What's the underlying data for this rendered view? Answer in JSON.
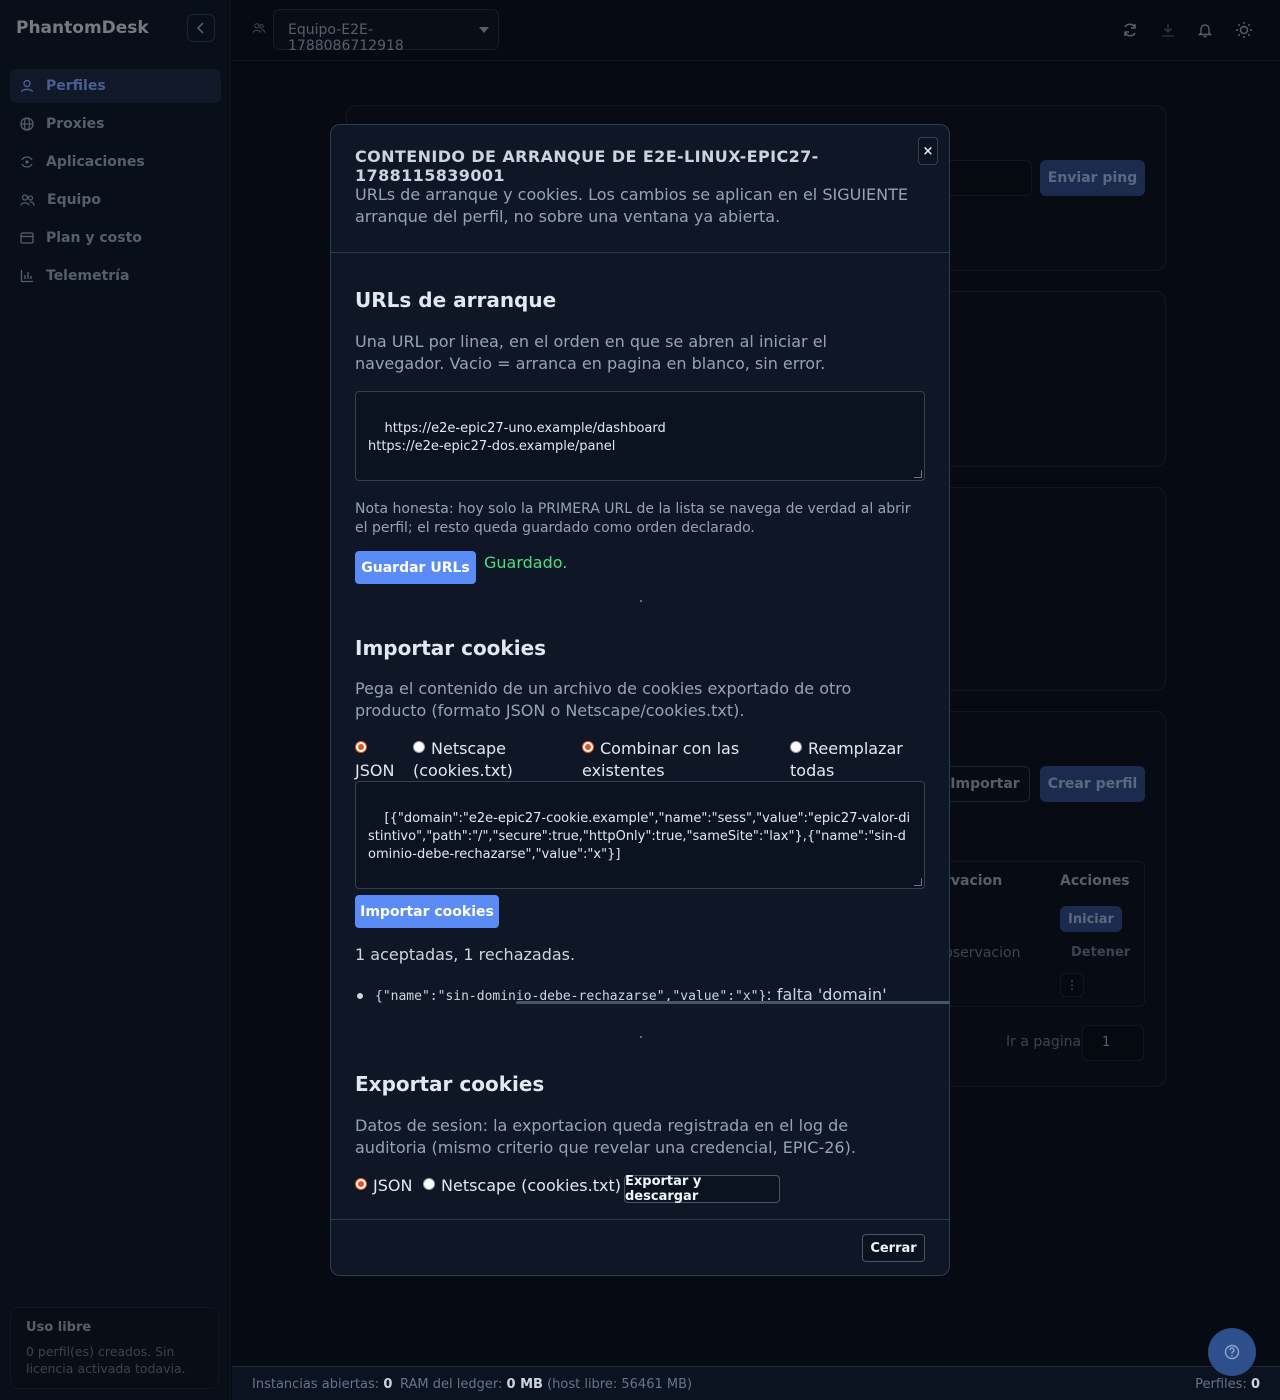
{
  "app": {
    "brand": "PhantomDesk"
  },
  "sidebar": {
    "items": [
      {
        "label": "Perfiles",
        "icon": "user-icon",
        "active": true
      },
      {
        "label": "Proxies",
        "icon": "globe-icon"
      },
      {
        "label": "Aplicaciones",
        "icon": "apps-icon"
      },
      {
        "label": "Equipo",
        "icon": "team-icon"
      },
      {
        "label": "Plan y costo",
        "icon": "card-icon"
      },
      {
        "label": "Telemetría",
        "icon": "chart-icon"
      }
    ],
    "usage": {
      "title": "Uso libre",
      "text": "0 perfil(es) creados. Sin licencia activada todavia."
    }
  },
  "topbar": {
    "team": "Equipo-E2E-1788086712918"
  },
  "background": {
    "ping_button": "Enviar ping",
    "import_button": "Importar",
    "create_button": "Crear perfil",
    "col_observacion": "rvacion",
    "col_acciones": "Acciones",
    "start_button": "Iniciar",
    "stop_button": "Detener",
    "observacion_cell": "bservacion",
    "goto_page_label": "Ir a pagina",
    "goto_page_value": "1"
  },
  "modal": {
    "title": "CONTENIDO DE ARRANQUE DE E2E-LINUX-EPIC27-1788115839001",
    "description": "URLs de arranque y cookies. Los cambios se aplican en el SIGUIENTE arranque del perfil, no sobre una ventana ya abierta.",
    "close_x": "×",
    "urls": {
      "heading": "URLs de arranque",
      "help": "Una URL por linea, en el orden en que se abren al iniciar el navegador. Vacio = arranca en pagina en blanco, sin error.",
      "value": "https://e2e-epic27-uno.example/dashboard\nhttps://e2e-epic27-dos.example/panel",
      "note": "Nota honesta: hoy solo la PRIMERA URL de la lista se navega de verdad al abrir el perfil; el resto queda guardado como orden declarado.",
      "save_button": "Guardar URLs",
      "saved_message": "Guardado."
    },
    "import": {
      "heading": "Importar cookies",
      "help": "Pega el contenido de un archivo de cookies exportado de otro producto (formato JSON o Netscape/cookies.txt).",
      "format_json": "JSON",
      "format_netscape": "Netscape (cookies.txt)",
      "mode_merge": "Combinar con las existentes",
      "mode_replace": "Reemplazar todas",
      "value": "[{\"domain\":\"e2e-epic27-cookie.example\",\"name\":\"sess\",\"value\":\"epic27-valor-distintivo\",\"path\":\"/\",\"secure\":true,\"httpOnly\":true,\"sameSite\":\"lax\"},{\"name\":\"sin-dominio-debe-rechazarse\",\"value\":\"x\"}]",
      "import_button": "Importar cookies",
      "result": "1 aceptadas, 1 rechazadas.",
      "rejected_code": "{\"name\":\"sin-dominio-debe-rechazarse\",\"value\":\"x\"}",
      "rejected_reason": ": falta 'domain'"
    },
    "export": {
      "heading": "Exportar cookies",
      "help": "Datos de sesion: la exportacion queda registrada en el log de auditoria (mismo criterio que revelar una credencial, EPIC-26).",
      "format_json": "JSON",
      "format_netscape": "Netscape (cookies.txt)",
      "export_button": "Exportar y descargar"
    },
    "close_button": "Cerrar"
  },
  "statusbar": {
    "instances_label": "Instancias abiertas:",
    "instances_value": "0",
    "ram_label": "RAM del ledger:",
    "ram_value": "0 MB",
    "host_free": "(host libre: 56461 MB)",
    "profiles_label": "Perfiles:",
    "profiles_value": "0"
  },
  "colors": {
    "accent": "#5b8cf5",
    "success": "#4ade80",
    "radio": "#e5531a"
  }
}
